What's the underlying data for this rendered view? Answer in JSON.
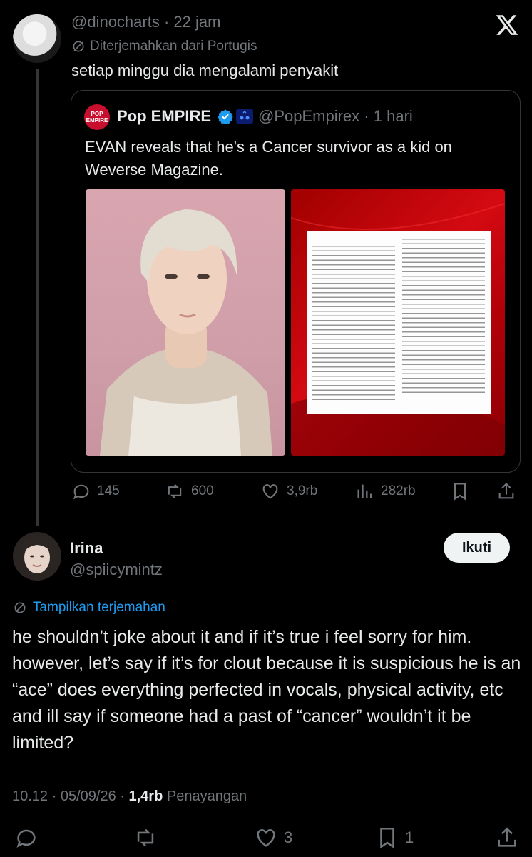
{
  "tweet": {
    "handle": "@dinocharts",
    "separator": "·",
    "time": "22 jam",
    "translated_note": "Diterjemahkan dari Portugis",
    "text": "setiap minggu dia mengalami penyakit",
    "quote": {
      "avatar_text_top": "POP",
      "avatar_text_bottom": "EMPIRE",
      "name": "Pop EMPIRE",
      "handle": "@PopEmpirex",
      "separator": "·",
      "time": "1 hari",
      "text": "EVAN reveals that he's a Cancer survivor as a kid on Weverse Magazine."
    },
    "actions": {
      "replies": "145",
      "reposts": "600",
      "likes": "3,9rb",
      "views": "282rb"
    }
  },
  "reply": {
    "name": "Irina",
    "handle": "@spiicymintz",
    "follow_label": "Ikuti",
    "show_translation": "Tampilkan terjemahan",
    "text": "he shouldn’t joke about it and if it’s true i feel sorry for him. however, let’s say if it’s for clout because it is suspicious he is an “ace” does everything perfected in vocals, physical activity, etc and ill say if someone had a past of “cancer” wouldn’t it be limited?",
    "time": "10.12",
    "date": "05/09/26",
    "views_count": "1,4rb",
    "views_label": "Penayangan",
    "actions": {
      "likes": "3",
      "bookmarks": "1"
    }
  },
  "colors": {
    "background": "#000000",
    "text": "#e7e9ea",
    "muted": "#71767b",
    "link": "#1d9bf0",
    "verified": "#1d9bf0",
    "border": "#333639"
  }
}
